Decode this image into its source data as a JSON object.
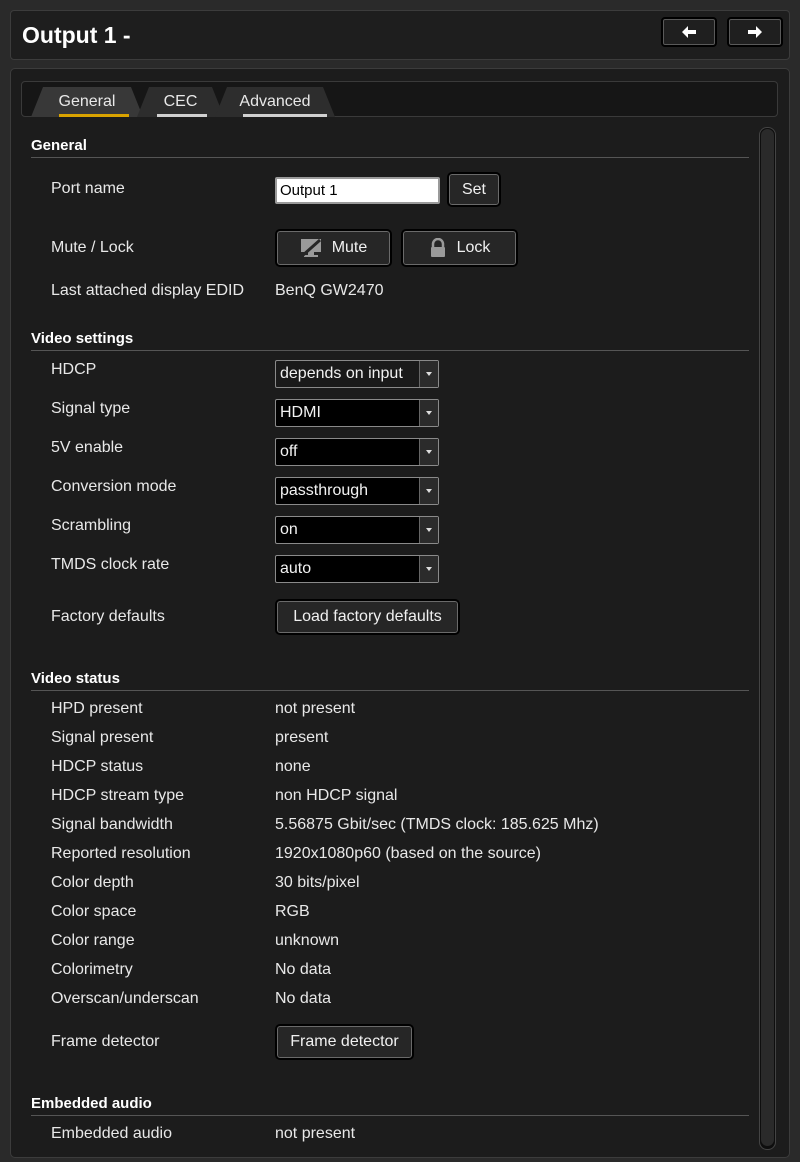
{
  "header": {
    "title": "Output 1 -"
  },
  "tabs": [
    {
      "label": "General",
      "underline": "#d9a300"
    },
    {
      "label": "CEC",
      "underline": "#d0d0d0"
    },
    {
      "label": "Advanced",
      "underline": "#d0d0d0"
    }
  ],
  "general": {
    "title": "General",
    "port_name": {
      "label": "Port name",
      "value": "Output 1",
      "button": "Set"
    },
    "mute_lock": {
      "label": "Mute / Lock",
      "mute": "Mute",
      "lock": "Lock"
    },
    "edid": {
      "label": "Last attached display EDID",
      "value": "BenQ GW2470"
    }
  },
  "video_settings": {
    "title": "Video settings",
    "hdcp": {
      "label": "HDCP",
      "value": "depends on input"
    },
    "signal_type": {
      "label": "Signal type",
      "value": "HDMI"
    },
    "five_v": {
      "label": "5V enable",
      "value": "off"
    },
    "conversion": {
      "label": "Conversion mode",
      "value": "passthrough"
    },
    "scrambling": {
      "label": "Scrambling",
      "value": "on"
    },
    "tmds": {
      "label": "TMDS clock rate",
      "value": "auto"
    },
    "factory": {
      "label": "Factory defaults",
      "button": "Load factory defaults"
    }
  },
  "video_status": {
    "title": "Video status",
    "rows": [
      {
        "label": "HPD present",
        "value": "not present"
      },
      {
        "label": "Signal present",
        "value": "present"
      },
      {
        "label": "HDCP status",
        "value": "none"
      },
      {
        "label": "HDCP stream type",
        "value": "non HDCP signal"
      },
      {
        "label": "Signal bandwidth",
        "value": "5.56875 Gbit/sec (TMDS clock: 185.625 Mhz)"
      },
      {
        "label": "Reported resolution",
        "value": "1920x1080p60 (based on the source)"
      },
      {
        "label": "Color depth",
        "value": "30 bits/pixel"
      },
      {
        "label": "Color space",
        "value": "RGB"
      },
      {
        "label": "Color range",
        "value": "unknown"
      },
      {
        "label": "Colorimetry",
        "value": "No data"
      },
      {
        "label": "Overscan/underscan",
        "value": "No data"
      }
    ],
    "frame_detector": {
      "label": "Frame detector",
      "button": "Frame detector"
    }
  },
  "embedded_audio": {
    "title": "Embedded audio",
    "row": {
      "label": "Embedded audio",
      "value": "not present"
    }
  }
}
